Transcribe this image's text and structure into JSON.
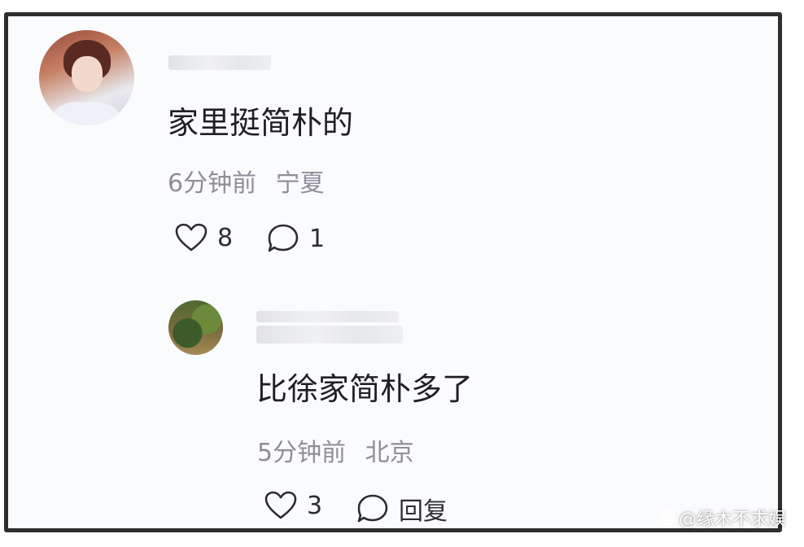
{
  "comment": {
    "author": "",
    "text": "家里挺简朴的",
    "time": "6分钟前",
    "location": "宁夏",
    "likes": "8",
    "replies": "1",
    "like_icon": "heart-icon",
    "reply_icon": "chat-bubble-icon"
  },
  "reply": {
    "author": "",
    "text": "比徐家简朴多了",
    "time": "5分钟前",
    "location": "北京",
    "likes": "3",
    "reply_label": "回复",
    "like_icon": "heart-icon",
    "reply_icon": "chat-bubble-icon"
  },
  "watermark": {
    "text": "@缘木不求娱",
    "icon": "paw-icon"
  },
  "colors": {
    "frame": "#2e2e2e",
    "background": "#fafbfd",
    "text": "#1f1f24",
    "meta": "#8f8e98"
  }
}
